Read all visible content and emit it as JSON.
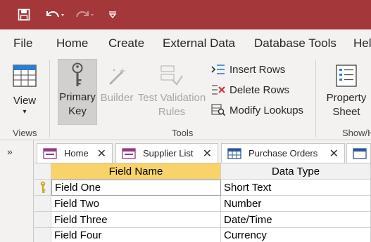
{
  "quick_access": {
    "save_icon": "save-icon",
    "undo_icon": "undo-icon",
    "redo_icon": "redo-icon",
    "customize_icon": "customize-qat-icon"
  },
  "menu": {
    "tabs": [
      "File",
      "Home",
      "Create",
      "External Data",
      "Database Tools",
      "Help"
    ],
    "tab_display": [
      "File",
      "Home",
      "Create",
      "External Data",
      "Database Tools",
      "Hel"
    ]
  },
  "ribbon": {
    "views_group": {
      "label": "Views",
      "view_button": "View"
    },
    "tools_group": {
      "label": "Tools",
      "primary_key_line1": "Primary",
      "primary_key_line2": "Key",
      "builder": "Builder",
      "test_validation_line1": "Test Validation",
      "test_validation_line2": "Rules",
      "insert_rows": "Insert Rows",
      "delete_rows": "Delete Rows",
      "modify_lookups": "Modify Lookups"
    },
    "showhide_group": {
      "label": "Show/H",
      "property_sheet_line1": "Property",
      "property_sheet_line2": "Sheet"
    }
  },
  "nav": {
    "toggle_symbol": "»"
  },
  "doc_tabs": [
    {
      "label": "Home",
      "close": "✕"
    },
    {
      "label": "Supplier List",
      "close": "✕"
    },
    {
      "label": "Purchase Orders",
      "close": "✕"
    }
  ],
  "design_grid": {
    "headers": {
      "field_name": "Field Name",
      "data_type": "Data Type"
    },
    "rows": [
      {
        "field_name": "Field One",
        "data_type": "Short Text",
        "primary_key": true
      },
      {
        "field_name": "Field Two",
        "data_type": "Number",
        "primary_key": false
      },
      {
        "field_name": "Field Three",
        "data_type": "Date/Time",
        "primary_key": false
      },
      {
        "field_name": "Field Four",
        "data_type": "Currency",
        "primary_key": false
      }
    ]
  },
  "colors": {
    "title_bar": "#a4373a",
    "ribbon_bg": "#f3f2f1",
    "active_header": "#f7d36a",
    "key_icon": "#c9a227"
  }
}
